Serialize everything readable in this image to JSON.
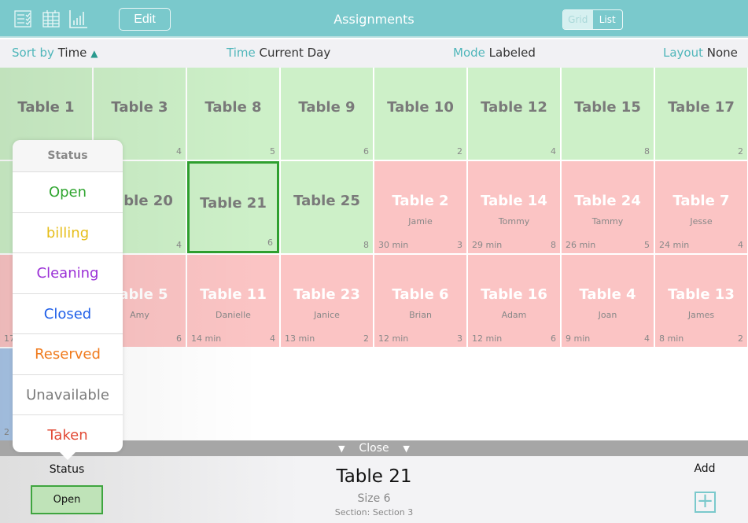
{
  "header": {
    "title": "Assignments",
    "edit_label": "Edit",
    "view_toggle": {
      "options": [
        "Grid",
        "List"
      ],
      "selected": "Grid"
    },
    "icons": [
      "checklist-icon",
      "calendar-icon",
      "bar-chart-icon"
    ],
    "color": "#7ac9cc"
  },
  "filters": {
    "sort": {
      "key": "Sort by",
      "value": "Time",
      "icon": "triangle-up-icon"
    },
    "time": {
      "key": "Time",
      "value": "Current Day"
    },
    "mode": {
      "key": "Mode",
      "value": "Labeled"
    },
    "layout": {
      "key": "Layout",
      "value": "None"
    }
  },
  "status_colors": {
    "open": "#cdf0c8",
    "taken": "#fbc4c4",
    "closed": "#a9c6e8"
  },
  "grid": [
    [
      {
        "name": "Table 1",
        "size": "",
        "status": "open"
      },
      {
        "name": "Table 3",
        "size": "4",
        "status": "open"
      },
      {
        "name": "Table 8",
        "size": "5",
        "status": "open"
      },
      {
        "name": "Table 9",
        "size": "6",
        "status": "open"
      },
      {
        "name": "Table 10",
        "size": "2",
        "status": "open"
      },
      {
        "name": "Table 12",
        "size": "4",
        "status": "open"
      },
      {
        "name": "Table 15",
        "size": "8",
        "status": "open"
      },
      {
        "name": "Table 17",
        "size": "2",
        "status": "open"
      }
    ],
    [
      {
        "name": "",
        "size": "",
        "status": "open"
      },
      {
        "name": "Table 20",
        "size": "4",
        "status": "open"
      },
      {
        "name": "Table 21",
        "size": "6",
        "status": "open",
        "selected": true
      },
      {
        "name": "Table 25",
        "size": "8",
        "status": "open"
      },
      {
        "name": "Table 2",
        "guest": "Jamie",
        "time": "30 min",
        "size": "3",
        "status": "taken"
      },
      {
        "name": "Table 14",
        "guest": "Tommy",
        "time": "29 min",
        "size": "8",
        "status": "taken"
      },
      {
        "name": "Table 24",
        "guest": "Tammy",
        "time": "26 min",
        "size": "5",
        "status": "taken"
      },
      {
        "name": "Table 7",
        "guest": "Jesse",
        "time": "24 min",
        "size": "4",
        "status": "taken"
      }
    ],
    [
      {
        "name": "",
        "time": "17",
        "size": "",
        "status": "taken"
      },
      {
        "name": "Table 5",
        "guest": "Amy",
        "size": "6",
        "status": "taken"
      },
      {
        "name": "Table 11",
        "guest": "Danielle",
        "time": "14 min",
        "size": "4",
        "status": "taken"
      },
      {
        "name": "Table 23",
        "guest": "Janice",
        "time": "13 min",
        "size": "2",
        "status": "taken"
      },
      {
        "name": "Table 6",
        "guest": "Brian",
        "time": "12 min",
        "size": "3",
        "status": "taken"
      },
      {
        "name": "Table 16",
        "guest": "Adam",
        "time": "12 min",
        "size": "6",
        "status": "taken"
      },
      {
        "name": "Table 4",
        "guest": "Joan",
        "time": "9 min",
        "size": "4",
        "status": "taken"
      },
      {
        "name": "Table 13",
        "guest": "James",
        "time": "8 min",
        "size": "2",
        "status": "taken"
      }
    ],
    [
      {
        "name": "",
        "time": "2 m",
        "size": "",
        "status": "closed"
      }
    ]
  ],
  "popover": {
    "title": "Status",
    "items": [
      {
        "label": "Open",
        "color": "#2fa52f"
      },
      {
        "label": "billing",
        "color": "#e6be1a"
      },
      {
        "label": "Cleaning",
        "color": "#9a2fd6"
      },
      {
        "label": "Closed",
        "color": "#1f5fe8"
      },
      {
        "label": "Reserved",
        "color": "#f07a1c"
      },
      {
        "label": "Unavailable",
        "color": "#7a7a7a"
      },
      {
        "label": "Taken",
        "color": "#e24a35"
      }
    ]
  },
  "close_bar": {
    "label": "Close"
  },
  "detail": {
    "status_label": "Status",
    "status_value": "Open",
    "title": "Table 21",
    "size": "Size 6",
    "section": "Section: Section 3",
    "add_label": "Add"
  }
}
